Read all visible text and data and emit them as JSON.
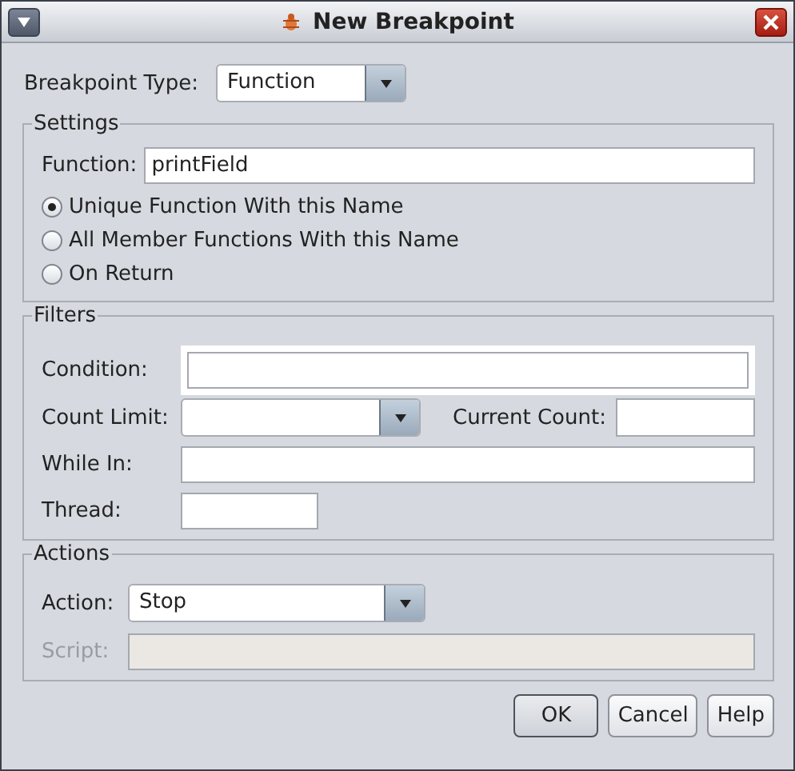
{
  "window": {
    "title": "New Breakpoint"
  },
  "breakpoint_type": {
    "label": "Breakpoint Type:",
    "value": "Function"
  },
  "settings": {
    "title": "Settings",
    "function": {
      "label": "Function:",
      "value": "printField"
    },
    "options": [
      {
        "label": "Unique Function With this Name",
        "selected": true
      },
      {
        "label": "All Member Functions With this Name",
        "selected": false
      },
      {
        "label": "On Return",
        "selected": false
      }
    ]
  },
  "filters": {
    "title": "Filters",
    "condition": {
      "label": "Condition:",
      "focused": true
    },
    "count_limit": {
      "label": "Count Limit:"
    },
    "current_count": {
      "label": "Current Count:"
    },
    "while_in": {
      "label": "While In:"
    },
    "thread": {
      "label": "Thread:"
    }
  },
  "actions": {
    "title": "Actions",
    "action": {
      "label": "Action:",
      "value": "Stop"
    },
    "script": {
      "label": "Script:",
      "disabled": true
    }
  },
  "buttons": [
    {
      "label": "OK",
      "default": true
    },
    {
      "label": "Cancel",
      "default": false
    },
    {
      "label": "Help",
      "default": false
    }
  ]
}
